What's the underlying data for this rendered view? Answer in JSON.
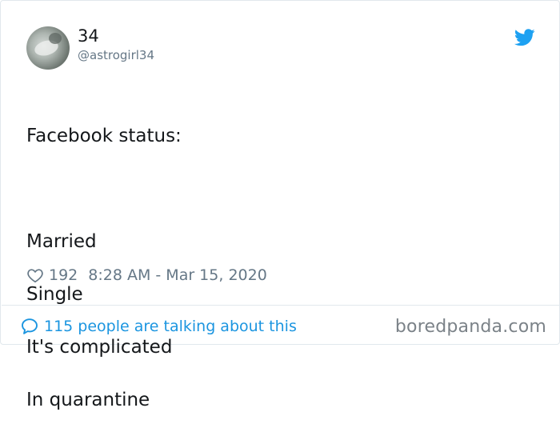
{
  "tweet": {
    "display_name": "34",
    "handle": "@astrogirl34",
    "text_lines": [
      "Facebook status:",
      "",
      "Married",
      "Single",
      "It's complicated",
      "In quarantine"
    ],
    "likes": "192",
    "timestamp": "8:28 AM - Mar 15, 2020"
  },
  "footer": {
    "conversation_label": "115 people are talking about this"
  },
  "watermark": "boredpanda.com",
  "colors": {
    "twitter_blue": "#1da1f2",
    "link_blue": "#1b95e0",
    "secondary_text": "#657786"
  },
  "icons": {
    "platform": "twitter-bird-icon",
    "like": "heart-icon",
    "reply": "speech-bubble-icon"
  }
}
